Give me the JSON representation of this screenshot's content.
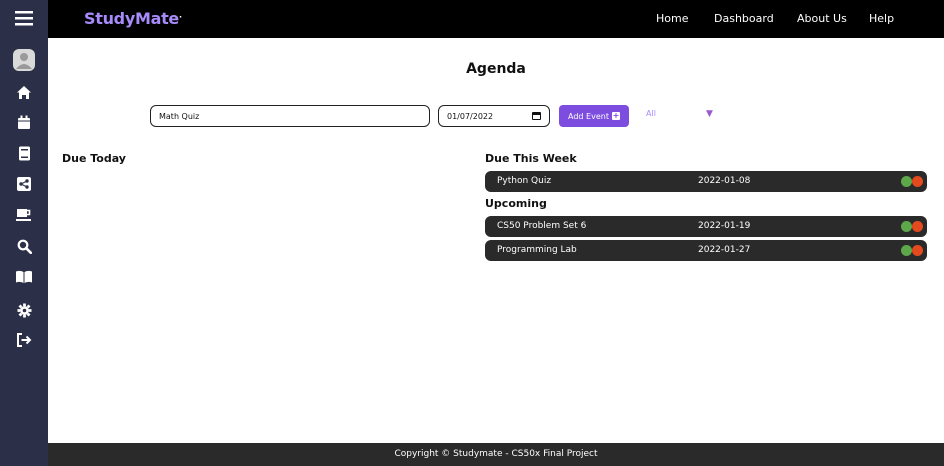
{
  "brand": {
    "name": "StudyMate",
    "mark": "."
  },
  "nav": {
    "home": "Home",
    "dashboard": "Dashboard",
    "about": "About Us",
    "help": "Help"
  },
  "sidebar": {
    "icons": [
      "menu-icon",
      "avatar",
      "home-icon",
      "calendar-icon",
      "notebook-icon",
      "share-icon",
      "coffee-icon",
      "search-icon",
      "book-icon",
      "gear-icon",
      "logout-icon"
    ]
  },
  "page": {
    "title": "Agenda"
  },
  "form": {
    "event_value": "Math Quiz",
    "date_value": "01/07/2022",
    "add_label": "Add Event",
    "filter_value": "All"
  },
  "sections": {
    "due_today": "Due Today",
    "due_week": "Due This Week",
    "upcoming": "Upcoming"
  },
  "events": {
    "week": [
      {
        "name": "Python Quiz",
        "date": "2022-01-08"
      }
    ],
    "upcoming": [
      {
        "name": "CS50 Problem Set 6",
        "date": "2022-01-19"
      },
      {
        "name": "Programming Lab",
        "date": "2022-01-27"
      }
    ]
  },
  "colors": {
    "sidebar": "#2b3048",
    "accent": "#7c4dde",
    "brand": "#a78bfa",
    "done": "#5ea84a",
    "delete": "#e34b1f"
  },
  "footer": {
    "text": "Copyright © Studymate - CS50x Final Project"
  }
}
